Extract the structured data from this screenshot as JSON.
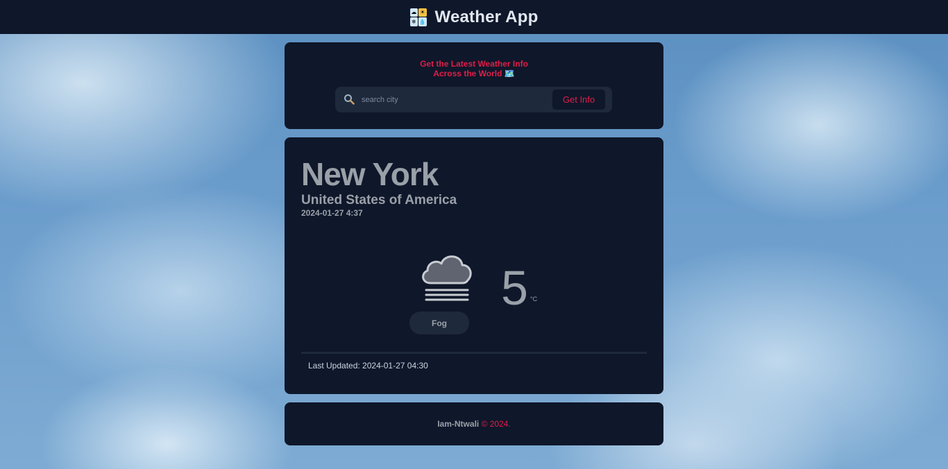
{
  "header": {
    "title": "Weather App",
    "logo_icon": "weather-app-icon"
  },
  "search": {
    "headline_line1": "Get the Latest Weather Info",
    "headline_line2": "Across the World 🗺️",
    "placeholder": "search city",
    "value": "",
    "button_label": "Get Info",
    "icon": "search-icon"
  },
  "weather": {
    "city": "New York",
    "country": "United States of America",
    "local_time": "2024-01-27 4:37",
    "condition": "Fog",
    "condition_icon": "fog-icon",
    "temperature": "5",
    "unit": "°C",
    "last_updated": "Last Updated: 2024-01-27 04:30"
  },
  "footer": {
    "author": "Iam-Ntwali",
    "copyright": " © 2024."
  },
  "colors": {
    "panel": "#0f172a",
    "input_bg": "#1e293b",
    "accent": "#e11d48",
    "text_muted": "#9aa0a8"
  }
}
